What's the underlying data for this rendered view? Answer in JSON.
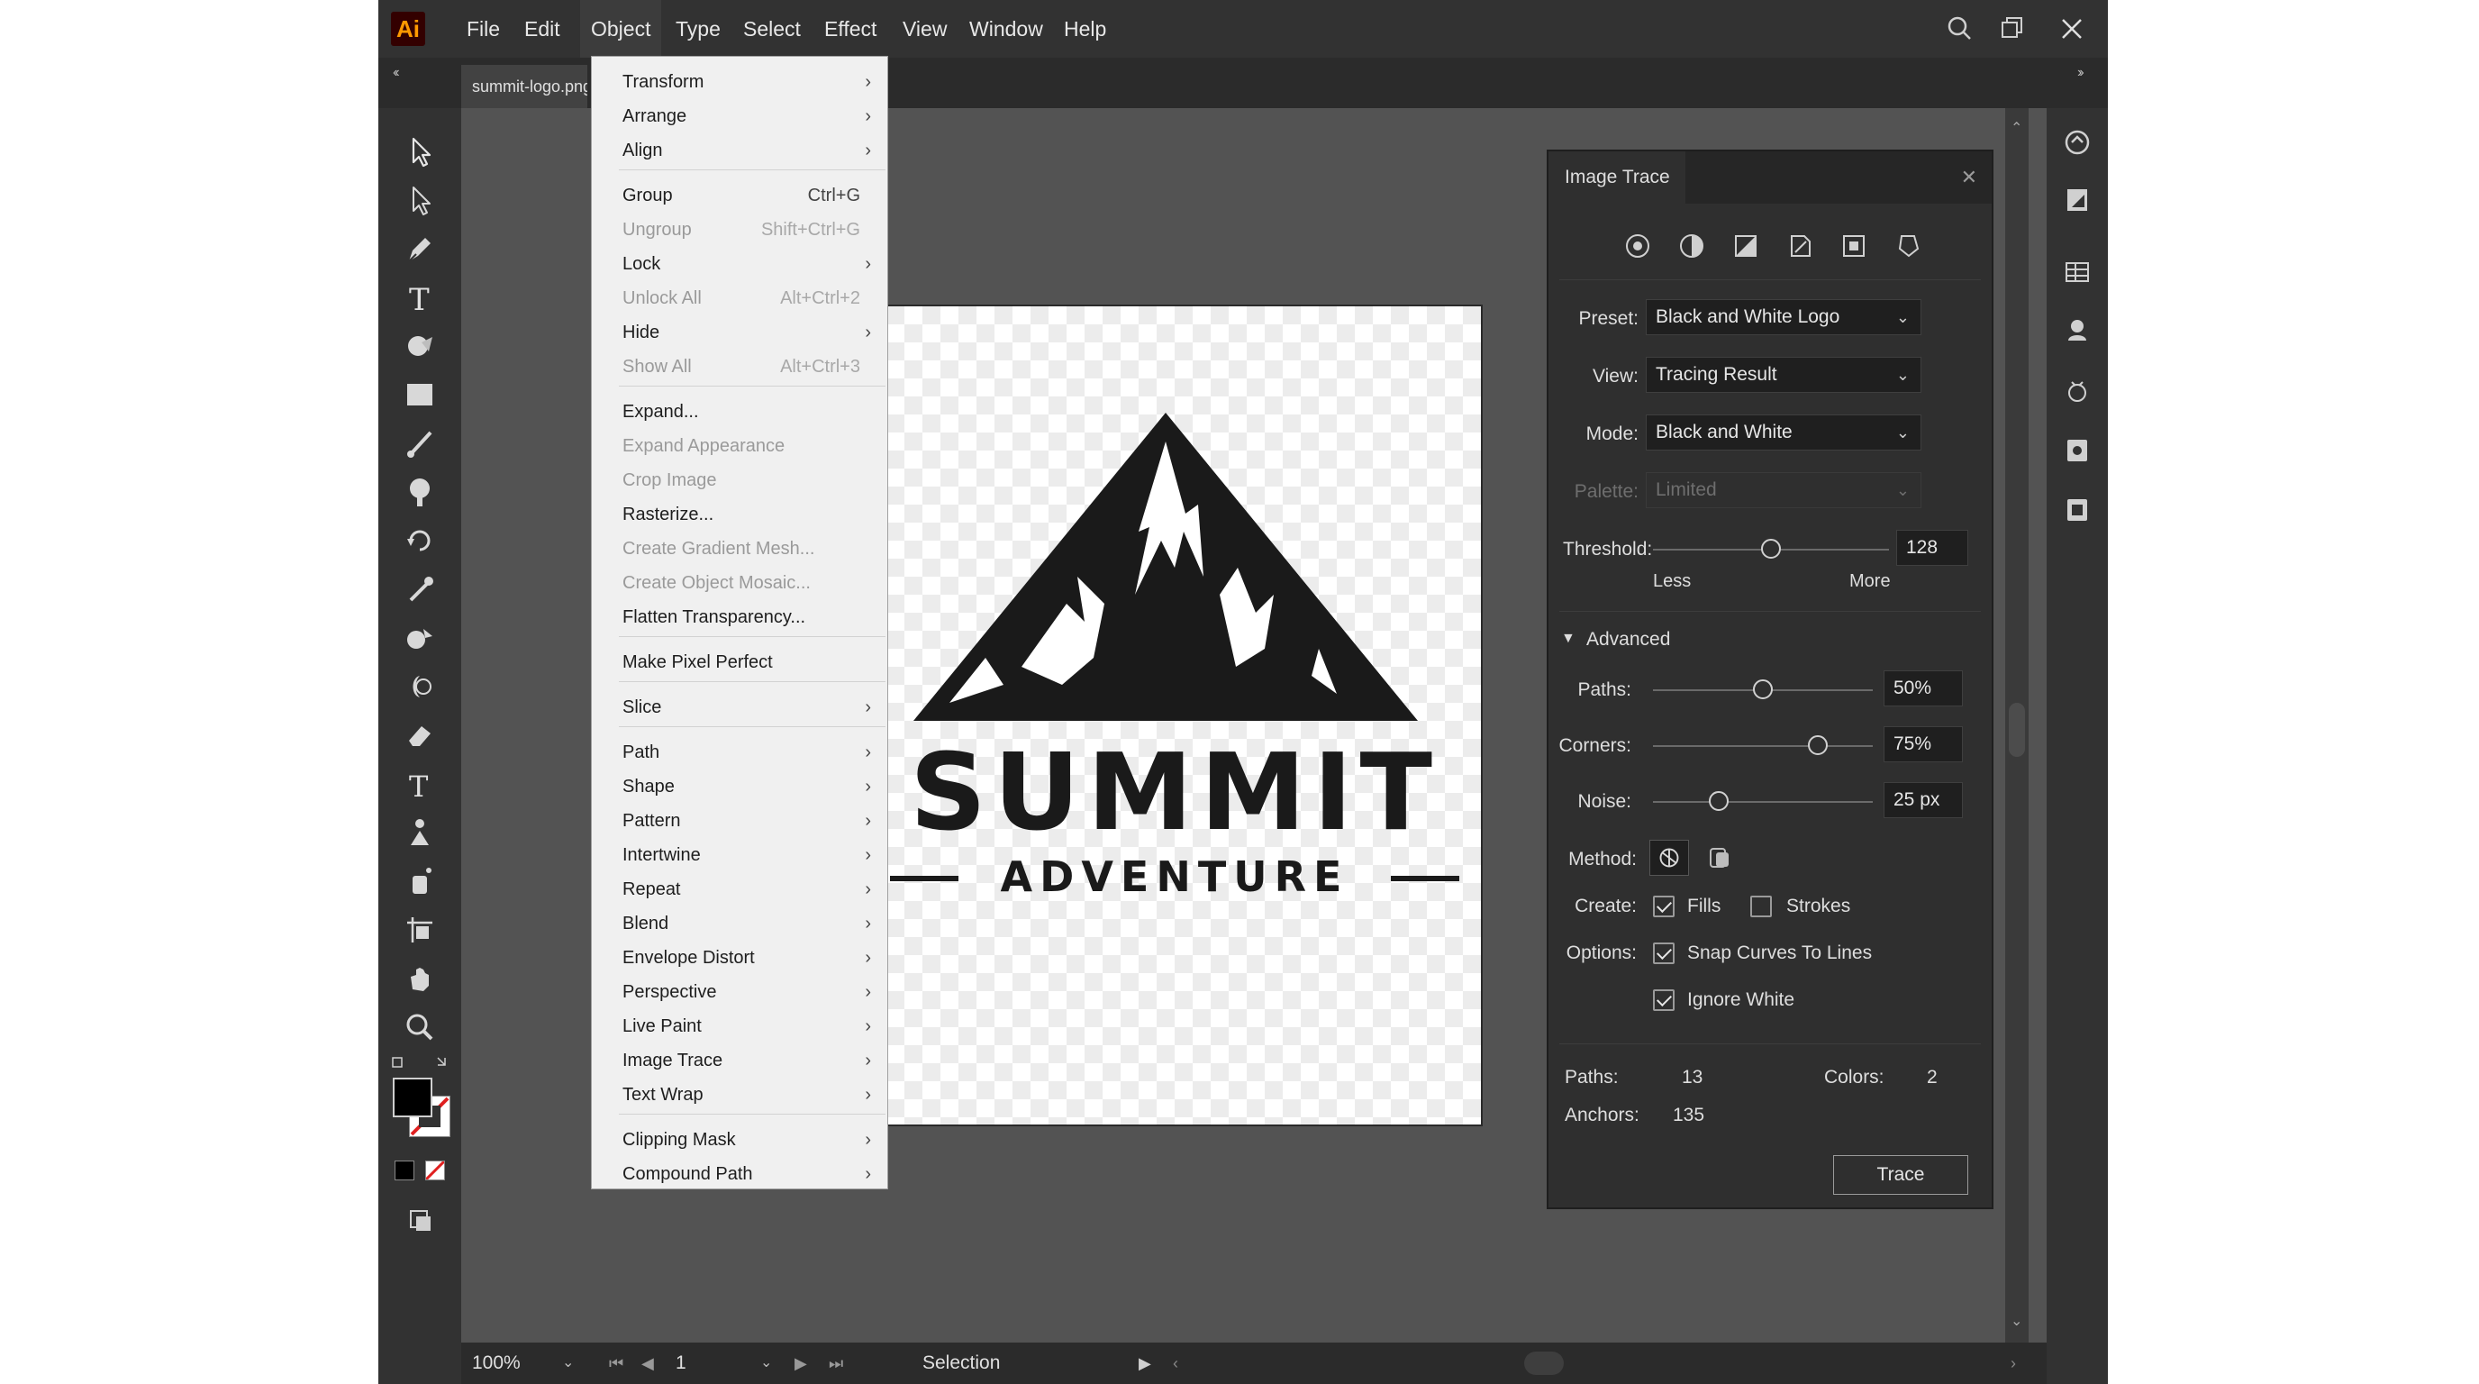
{
  "app": {
    "logo_text": "Ai"
  },
  "menubar": {
    "items": [
      "File",
      "Edit",
      "Object",
      "Type",
      "Select",
      "Effect",
      "View",
      "Window",
      "Help"
    ],
    "active": "Object"
  },
  "document": {
    "tab_label": "summit-logo.png*"
  },
  "artwork": {
    "title": "SUMMIT",
    "subtitle": "ADVENTURE"
  },
  "object_menu": {
    "items": [
      {
        "label": "Transform",
        "shortcut": "",
        "submenu": true,
        "disabled": false
      },
      {
        "label": "Arrange",
        "shortcut": "",
        "submenu": true,
        "disabled": false
      },
      {
        "label": "Align",
        "shortcut": "",
        "submenu": true,
        "disabled": false
      },
      {
        "label": "Group",
        "shortcut": "Ctrl+G",
        "submenu": false,
        "disabled": false
      },
      {
        "label": "Ungroup",
        "shortcut": "Shift+Ctrl+G",
        "submenu": false,
        "disabled": true
      },
      {
        "label": "Lock",
        "shortcut": "",
        "submenu": true,
        "disabled": false
      },
      {
        "label": "Unlock All",
        "shortcut": "Alt+Ctrl+2",
        "submenu": false,
        "disabled": true
      },
      {
        "label": "Hide",
        "shortcut": "",
        "submenu": true,
        "disabled": false
      },
      {
        "label": "Show All",
        "shortcut": "Alt+Ctrl+3",
        "submenu": false,
        "disabled": true
      },
      {
        "label": "Expand...",
        "shortcut": "",
        "submenu": false,
        "disabled": false
      },
      {
        "label": "Expand Appearance",
        "shortcut": "",
        "submenu": false,
        "disabled": true
      },
      {
        "label": "Crop Image",
        "shortcut": "",
        "submenu": false,
        "disabled": true
      },
      {
        "label": "Rasterize...",
        "shortcut": "",
        "submenu": false,
        "disabled": false
      },
      {
        "label": "Create Gradient Mesh...",
        "shortcut": "",
        "submenu": false,
        "disabled": true
      },
      {
        "label": "Create Object Mosaic...",
        "shortcut": "",
        "submenu": false,
        "disabled": true
      },
      {
        "label": "Flatten Transparency...",
        "shortcut": "",
        "submenu": false,
        "disabled": false
      },
      {
        "label": "Make Pixel Perfect",
        "shortcut": "",
        "submenu": false,
        "disabled": false
      },
      {
        "label": "Slice",
        "shortcut": "",
        "submenu": true,
        "disabled": false
      },
      {
        "label": "Path",
        "shortcut": "",
        "submenu": true,
        "disabled": false
      },
      {
        "label": "Shape",
        "shortcut": "",
        "submenu": true,
        "disabled": false
      },
      {
        "label": "Pattern",
        "shortcut": "",
        "submenu": true,
        "disabled": false
      },
      {
        "label": "Intertwine",
        "shortcut": "",
        "submenu": true,
        "disabled": false
      },
      {
        "label": "Repeat",
        "shortcut": "",
        "submenu": true,
        "disabled": false
      },
      {
        "label": "Blend",
        "shortcut": "",
        "submenu": true,
        "disabled": false
      },
      {
        "label": "Envelope Distort",
        "shortcut": "",
        "submenu": true,
        "disabled": false
      },
      {
        "label": "Perspective",
        "shortcut": "",
        "submenu": true,
        "disabled": false
      },
      {
        "label": "Live Paint",
        "shortcut": "",
        "submenu": true,
        "disabled": false
      },
      {
        "label": "Image Trace",
        "shortcut": "",
        "submenu": true,
        "disabled": false
      },
      {
        "label": "Text Wrap",
        "shortcut": "",
        "submenu": true,
        "disabled": false
      },
      {
        "label": "Clipping Mask",
        "shortcut": "",
        "submenu": true,
        "disabled": false
      },
      {
        "label": "Compound Path",
        "shortcut": "",
        "submenu": true,
        "disabled": false
      }
    ]
  },
  "image_trace": {
    "tab_title": "Image Trace",
    "preset_label": "Preset:",
    "preset_value": "Black and White Logo",
    "view_label": "View:",
    "view_value": "Tracing Result",
    "mode_label": "Mode:",
    "mode_value": "Black and White",
    "palette_label": "Palette:",
    "palette_value": "Limited",
    "threshold_label": "Threshold:",
    "threshold_value": "128",
    "threshold_min": 1,
    "threshold_max": 255,
    "less_label": "Less",
    "more_label": "More",
    "advanced_label": "Advanced",
    "paths_label": "Paths:",
    "paths_value": "50%",
    "paths_fraction": 0.5,
    "corners_label": "Corners:",
    "corners_value": "75%",
    "corners_fraction": 0.75,
    "noise_label": "Noise:",
    "noise_value": "25 px",
    "noise_fraction": 0.3,
    "method_label": "Method:",
    "create_label": "Create:",
    "fills_label": "Fills",
    "fills_checked": true,
    "strokes_label": "Strokes",
    "strokes_checked": false,
    "options_label": "Options:",
    "snap_label": "Snap Curves To Lines",
    "snap_checked": true,
    "ignore_white_label": "Ignore White",
    "ignore_white_checked": true,
    "stat_paths_label": "Paths:",
    "stat_paths_value": "13",
    "stat_colors_label": "Colors:",
    "stat_colors_value": "2",
    "stat_anchors_label": "Anchors:",
    "stat_anchors_value": "135",
    "trace_button": "Trace"
  },
  "statusbar": {
    "zoom": "100%",
    "artboard_number": "1",
    "tool_name": "Selection"
  },
  "colors": {
    "fill": "#000000",
    "stroke_none": "#e02020",
    "ui_dark": "#323232",
    "canvas": "#535353"
  },
  "icons": [
    "selection-tool-icon",
    "direct-selection-tool-icon",
    "pen-tool-icon",
    "type-tool-icon",
    "shape-builder-icon",
    "rectangle-tool-icon",
    "paintbrush-tool-icon",
    "blob-brush-icon",
    "rotate-tool-icon",
    "eyedropper-tool-icon",
    "shaper-tool-icon",
    "warp-tool-icon",
    "eraser-tool-icon",
    "touch-type-tool-icon",
    "puppet-warp-icon",
    "symbol-sprayer-icon",
    "artboard-tool-icon",
    "hand-tool-icon",
    "zoom-tool-icon"
  ]
}
